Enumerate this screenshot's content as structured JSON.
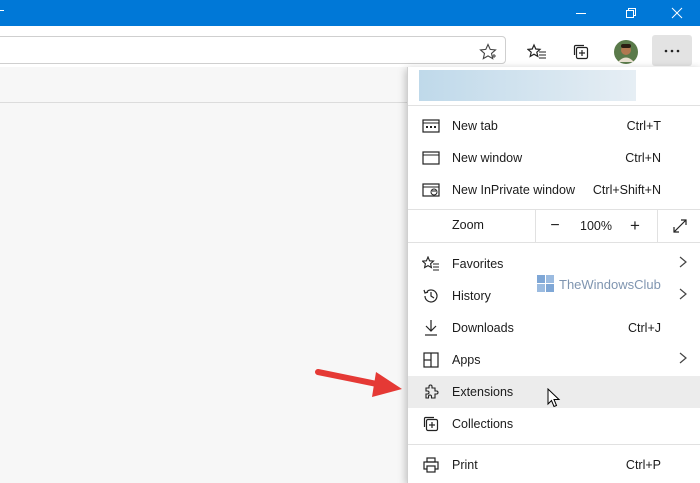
{
  "window": {
    "minimize_icon": "minimize-icon",
    "restore_icon": "restore-icon",
    "close_icon": "close-icon"
  },
  "toolbar": {
    "icons": [
      "add-favorite-star-icon",
      "favorites-icon",
      "collections-icon",
      "profile-avatar",
      "more-options-icon"
    ]
  },
  "menu": {
    "items_top": [
      {
        "name": "new-tab",
        "label": "New tab",
        "shortcut": "Ctrl+T",
        "icon": "new-tab-icon"
      },
      {
        "name": "new-window",
        "label": "New window",
        "shortcut": "Ctrl+N",
        "icon": "new-window-icon"
      },
      {
        "name": "new-inprivate-window",
        "label": "New InPrivate window",
        "shortcut": "Ctrl+Shift+N",
        "icon": "inprivate-icon"
      }
    ],
    "zoom": {
      "label": "Zoom",
      "value": "100%",
      "minus": "−",
      "plus": "+"
    },
    "items_mid": [
      {
        "name": "favorites",
        "label": "Favorites",
        "shortcut": "",
        "icon": "favorites-icon",
        "submenu": true
      },
      {
        "name": "history",
        "label": "History",
        "shortcut": "",
        "icon": "history-icon",
        "submenu": true
      },
      {
        "name": "downloads",
        "label": "Downloads",
        "shortcut": "Ctrl+J",
        "icon": "download-icon",
        "submenu": false
      },
      {
        "name": "apps",
        "label": "Apps",
        "shortcut": "",
        "icon": "apps-icon",
        "submenu": true
      },
      {
        "name": "extensions",
        "label": "Extensions",
        "shortcut": "",
        "icon": "extensions-icon",
        "submenu": false,
        "hover": true
      },
      {
        "name": "collections",
        "label": "Collections",
        "shortcut": "",
        "icon": "collections-icon",
        "submenu": false
      }
    ],
    "items_bottom": [
      {
        "name": "print",
        "label": "Print",
        "shortcut": "Ctrl+P",
        "icon": "print-icon"
      }
    ]
  },
  "watermark": {
    "text": "TheWindowsClub"
  },
  "colors": {
    "titlebar": "#0078d7",
    "arrow": "#e53935",
    "hover": "#ececec"
  }
}
